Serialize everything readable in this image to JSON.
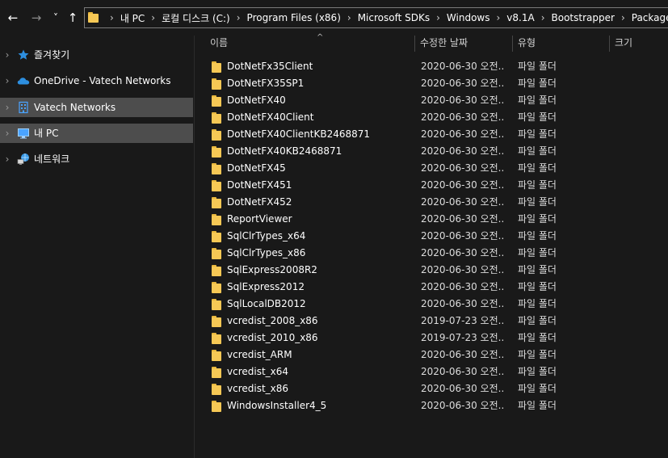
{
  "nav": {
    "back_glyph": "←",
    "forward_glyph": "→",
    "recent_glyph": "˅",
    "up_glyph": "↑"
  },
  "address": {
    "segments": [
      "내 PC",
      "로컬 디스크 (C:)",
      "Program Files (x86)",
      "Microsoft SDKs",
      "Windows",
      "v8.1A",
      "Bootstrapper",
      "Packages"
    ],
    "separator": "›"
  },
  "sidebar": {
    "items": [
      {
        "label": "즐겨찾기",
        "icon": "star-icon",
        "selected": false
      },
      {
        "label": "OneDrive - Vatech Networks",
        "icon": "cloud-icon",
        "selected": false
      },
      {
        "label": "Vatech Networks",
        "icon": "building-icon",
        "selected": true
      },
      {
        "label": "내 PC",
        "icon": "computer-icon",
        "selected": true
      },
      {
        "label": "네트워크",
        "icon": "network-icon",
        "selected": false
      }
    ],
    "chevron": "›"
  },
  "columns": {
    "name": "이름",
    "date": "수정한 날짜",
    "type": "유형",
    "size": "크기",
    "sort_glyph": "^"
  },
  "files": [
    {
      "name": "DotNetFx35Client",
      "date": "2020-06-30 오전...",
      "type": "파일 폴더"
    },
    {
      "name": "DotNetFX35SP1",
      "date": "2020-06-30 오전...",
      "type": "파일 폴더"
    },
    {
      "name": "DotNetFX40",
      "date": "2020-06-30 오전...",
      "type": "파일 폴더"
    },
    {
      "name": "DotNetFX40Client",
      "date": "2020-06-30 오전...",
      "type": "파일 폴더"
    },
    {
      "name": "DotNetFX40ClientKB2468871",
      "date": "2020-06-30 오전...",
      "type": "파일 폴더"
    },
    {
      "name": "DotNetFX40KB2468871",
      "date": "2020-06-30 오전...",
      "type": "파일 폴더"
    },
    {
      "name": "DotNetFX45",
      "date": "2020-06-30 오전...",
      "type": "파일 폴더"
    },
    {
      "name": "DotNetFX451",
      "date": "2020-06-30 오전...",
      "type": "파일 폴더"
    },
    {
      "name": "DotNetFX452",
      "date": "2020-06-30 오전...",
      "type": "파일 폴더"
    },
    {
      "name": "ReportViewer",
      "date": "2020-06-30 오전...",
      "type": "파일 폴더"
    },
    {
      "name": "SqlClrTypes_x64",
      "date": "2020-06-30 오전...",
      "type": "파일 폴더"
    },
    {
      "name": "SqlClrTypes_x86",
      "date": "2020-06-30 오전...",
      "type": "파일 폴더"
    },
    {
      "name": "SqlExpress2008R2",
      "date": "2020-06-30 오전...",
      "type": "파일 폴더"
    },
    {
      "name": "SqlExpress2012",
      "date": "2020-06-30 오전...",
      "type": "파일 폴더"
    },
    {
      "name": "SqlLocalDB2012",
      "date": "2020-06-30 오전...",
      "type": "파일 폴더"
    },
    {
      "name": "vcredist_2008_x86",
      "date": "2019-07-23 오전...",
      "type": "파일 폴더"
    },
    {
      "name": "vcredist_2010_x86",
      "date": "2019-07-23 오전...",
      "type": "파일 폴더"
    },
    {
      "name": "vcredist_ARM",
      "date": "2020-06-30 오전...",
      "type": "파일 폴더"
    },
    {
      "name": "vcredist_x64",
      "date": "2020-06-30 오전...",
      "type": "파일 폴더"
    },
    {
      "name": "vcredist_x86",
      "date": "2020-06-30 오전...",
      "type": "파일 폴더"
    },
    {
      "name": "WindowsInstaller4_5",
      "date": "2020-06-30 오전...",
      "type": "파일 폴더"
    }
  ]
}
